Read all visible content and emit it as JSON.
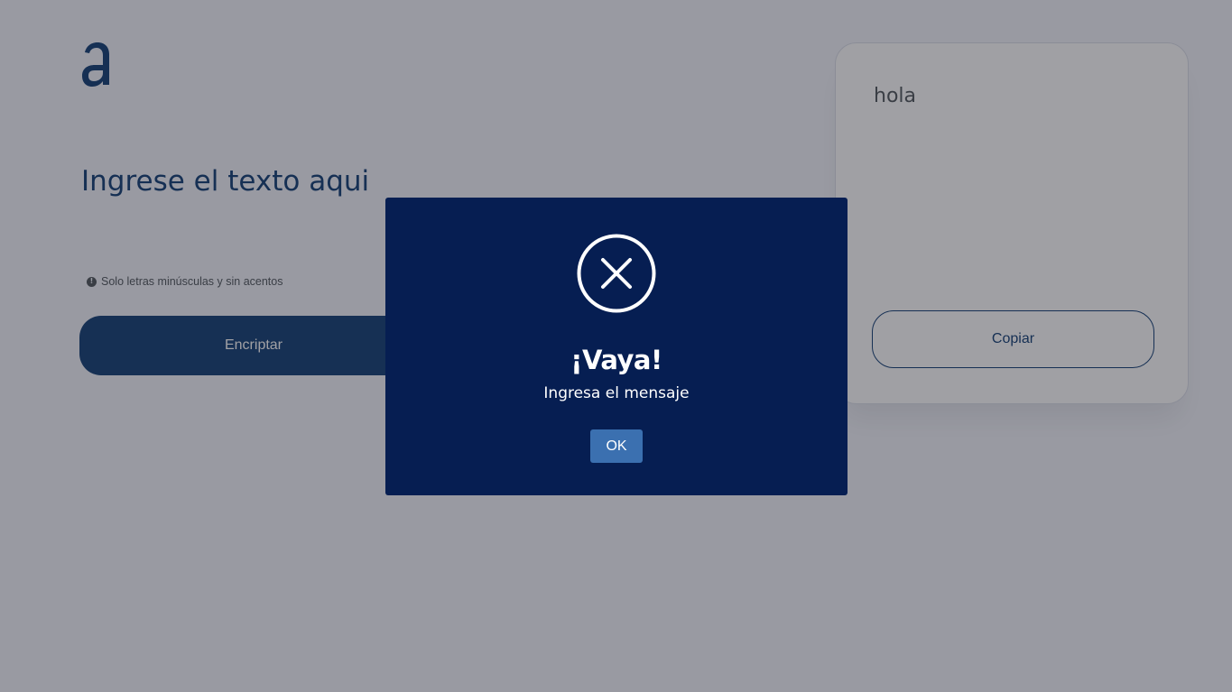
{
  "app": {
    "logo_icon": "alura-a-logo-icon",
    "brand_color": "#0A3871"
  },
  "encryptor": {
    "input_placeholder": "Ingrese el texto aqui",
    "hint_icon": "exclamation-circle-icon",
    "hint_text": "Solo letras minúsculas y sin acentos",
    "encrypt_button": "Encriptar"
  },
  "output": {
    "text": "hola",
    "copy_button": "Copiar"
  },
  "dialog": {
    "icon": "error-x-circle-icon",
    "title": "¡Vaya!",
    "message": "Ingresa el mensaje",
    "ok_button": "OK",
    "background_color": "#061E52",
    "button_color": "#3B70B0"
  }
}
